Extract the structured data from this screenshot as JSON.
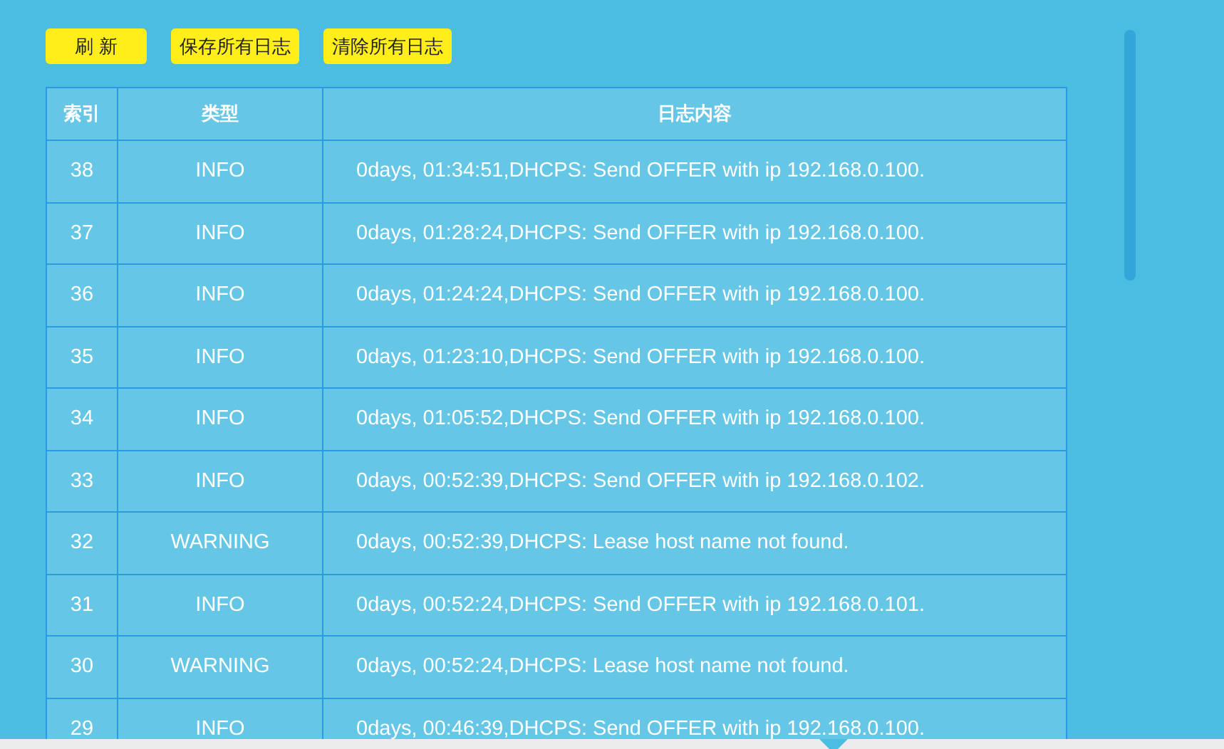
{
  "toolbar": {
    "buttons": [
      "刷 新",
      "保存所有日志",
      "清除所有日志"
    ]
  },
  "table": {
    "columns": [
      "索引",
      "类型",
      "日志内容"
    ],
    "rows": [
      {
        "index": "38",
        "type": "INFO",
        "content": "0days, 01:34:51,DHCPS: Send OFFER with ip 192.168.0.100."
      },
      {
        "index": "37",
        "type": "INFO",
        "content": "0days, 01:28:24,DHCPS: Send OFFER with ip 192.168.0.100."
      },
      {
        "index": "36",
        "type": "INFO",
        "content": "0days, 01:24:24,DHCPS: Send OFFER with ip 192.168.0.100."
      },
      {
        "index": "35",
        "type": "INFO",
        "content": "0days, 01:23:10,DHCPS: Send OFFER with ip 192.168.0.100."
      },
      {
        "index": "34",
        "type": "INFO",
        "content": "0days, 01:05:52,DHCPS: Send OFFER with ip 192.168.0.100."
      },
      {
        "index": "33",
        "type": "INFO",
        "content": "0days, 00:52:39,DHCPS: Send OFFER with ip 192.168.0.102."
      },
      {
        "index": "32",
        "type": "WARNING",
        "content": "0days, 00:52:39,DHCPS: Lease host name not found."
      },
      {
        "index": "31",
        "type": "INFO",
        "content": "0days, 00:52:24,DHCPS: Send OFFER with ip 192.168.0.101."
      },
      {
        "index": "30",
        "type": "WARNING",
        "content": "0days, 00:52:24,DHCPS: Lease host name not found."
      },
      {
        "index": "29",
        "type": "INFO",
        "content": "0days, 00:46:39,DHCPS: Send OFFER with ip 192.168.0.100."
      }
    ]
  }
}
